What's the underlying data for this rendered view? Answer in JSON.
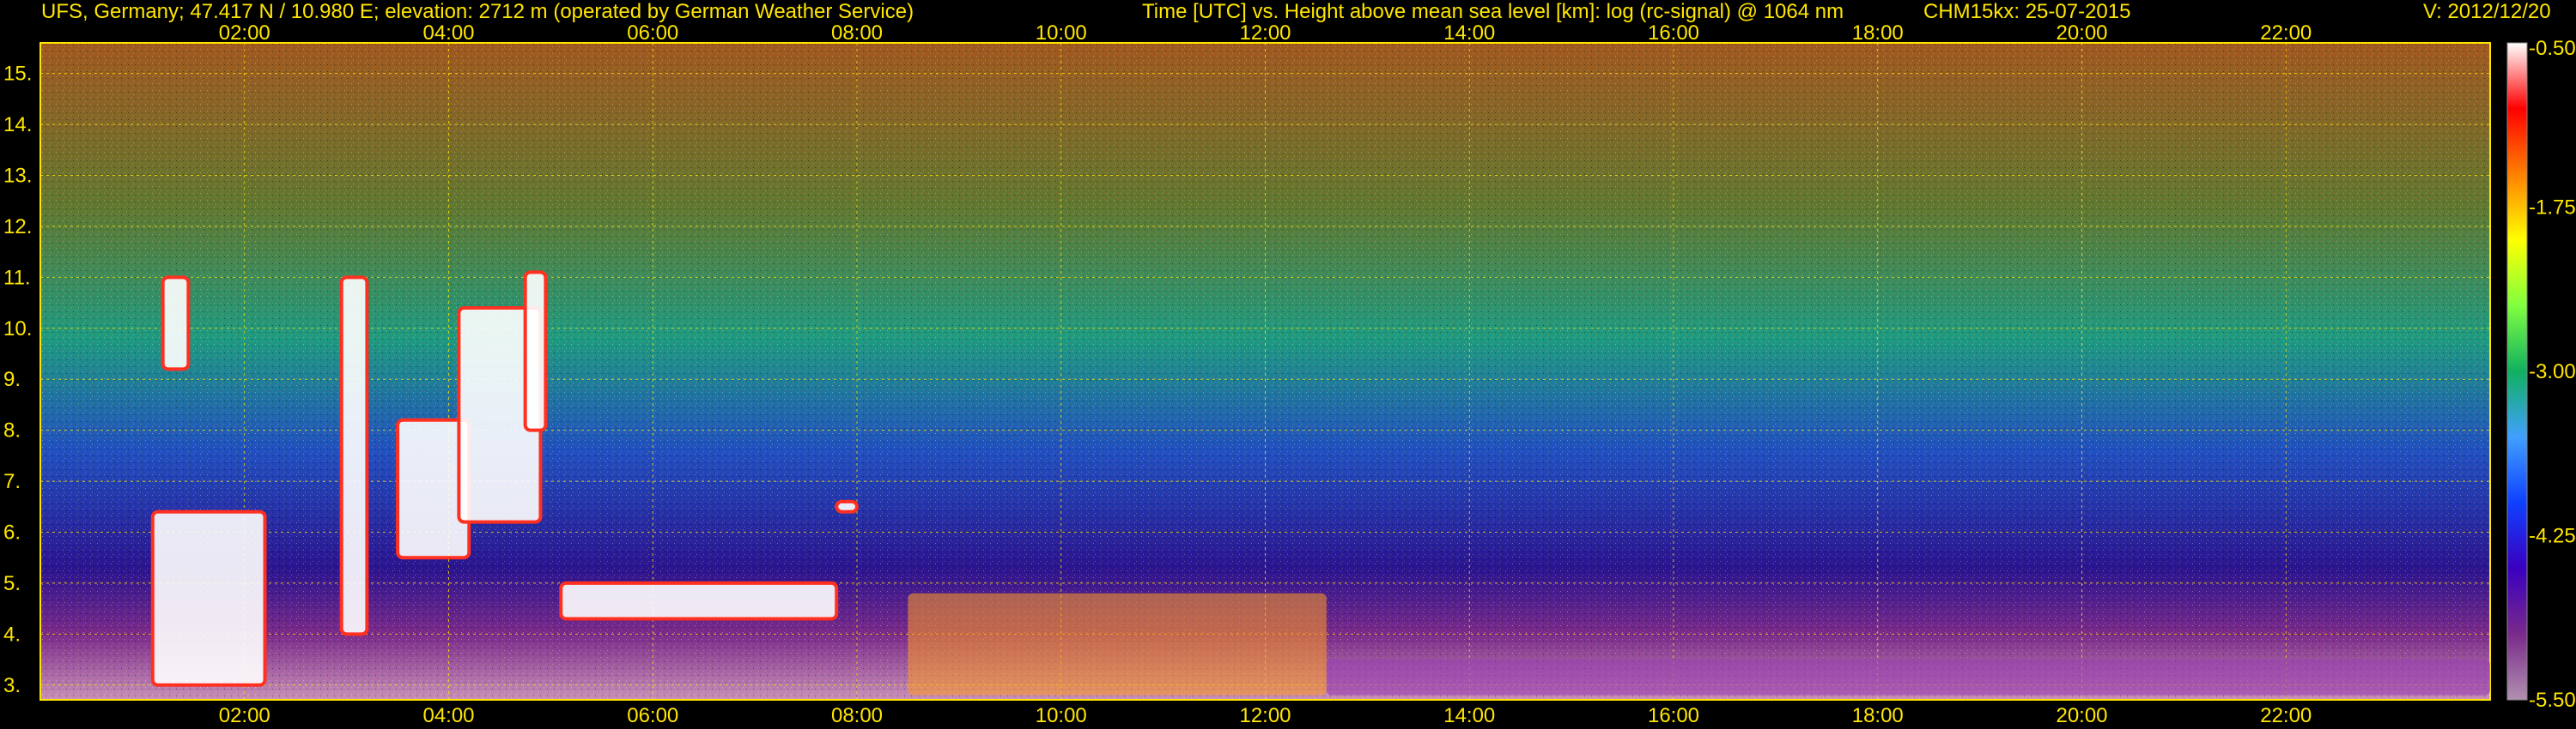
{
  "header": {
    "station": "UFS, Germany; 47.417 N / 10.980 E; elevation: 2712 m  (operated by German Weather Service)",
    "axes_desc": "Time [UTC] vs. Height above mean sea level [km]: log (rc-signal) @ 1064 nm",
    "instrument": "CHM15kx: 25-07-2015",
    "version": "V: 2012/12/20"
  },
  "colors": {
    "text": "#ffe600",
    "grid": "#ffe600",
    "background": "#000000"
  },
  "chart_data": {
    "type": "heatmap",
    "title": "Time [UTC] vs. Height above mean sea level [km]: log (rc-signal) @ 1064 nm",
    "xlabel": "Time [UTC]",
    "ylabel": "Height above mean sea level [km]",
    "x_ticks": [
      "02:00",
      "04:00",
      "06:00",
      "08:00",
      "10:00",
      "12:00",
      "14:00",
      "16:00",
      "18:00",
      "20:00",
      "22:00"
    ],
    "x_tick_hours": [
      2,
      4,
      6,
      8,
      10,
      12,
      14,
      16,
      18,
      20,
      22
    ],
    "xlim": [
      0,
      24
    ],
    "y_ticks": [
      "3.",
      "4.",
      "5.",
      "6.",
      "7.",
      "8.",
      "9.",
      "10.",
      "11.",
      "12.",
      "13.",
      "14.",
      "15."
    ],
    "y_tick_values": [
      3,
      4,
      5,
      6,
      7,
      8,
      9,
      10,
      11,
      12,
      13,
      14,
      15
    ],
    "ylim": [
      2.71,
      15.6
    ],
    "grid": true,
    "colorbar": {
      "ticks": [
        "-0.50",
        "-1.75",
        "-3.00",
        "-4.25",
        "-5.50"
      ],
      "tick_values": [
        -0.5,
        -1.75,
        -3.0,
        -4.25,
        -5.5
      ],
      "range": [
        -5.5,
        -0.5
      ],
      "colors": [
        "#b090b0",
        "#7a2a8a",
        "#3a00c0",
        "#1040ff",
        "#40a0ff",
        "#10b060",
        "#80ff40",
        "#ffff00",
        "#ff8000",
        "#ff0000",
        "#ffffff"
      ]
    },
    "features": [
      {
        "name": "cloud",
        "t_start": 1.1,
        "t_end": 2.2,
        "h_base": 3.0,
        "h_top": 6.4
      },
      {
        "name": "cloud",
        "t_start": 1.2,
        "t_end": 1.45,
        "h_base": 9.2,
        "h_top": 11.0
      },
      {
        "name": "cloud",
        "t_start": 2.95,
        "t_end": 3.2,
        "h_base": 4.0,
        "h_top": 11.0
      },
      {
        "name": "cloud",
        "t_start": 3.5,
        "t_end": 4.2,
        "h_base": 5.5,
        "h_top": 8.2
      },
      {
        "name": "cloud",
        "t_start": 4.1,
        "t_end": 4.9,
        "h_base": 6.2,
        "h_top": 10.4
      },
      {
        "name": "cloud",
        "t_start": 4.75,
        "t_end": 4.95,
        "h_base": 8.0,
        "h_top": 11.1
      },
      {
        "name": "cloud",
        "t_start": 5.1,
        "t_end": 7.8,
        "h_base": 4.3,
        "h_top": 5.0
      },
      {
        "name": "cloud",
        "t_start": 7.8,
        "t_end": 8.0,
        "h_base": 6.4,
        "h_top": 6.6
      },
      {
        "name": "boundary-layer",
        "t_start": 8.5,
        "t_end": 12.6,
        "h_base": 2.8,
        "h_top": 4.8
      },
      {
        "name": "aerosol-layer",
        "t_start": 12.6,
        "t_end": 24.0,
        "h_base": 2.8,
        "h_top": 3.5
      }
    ]
  }
}
